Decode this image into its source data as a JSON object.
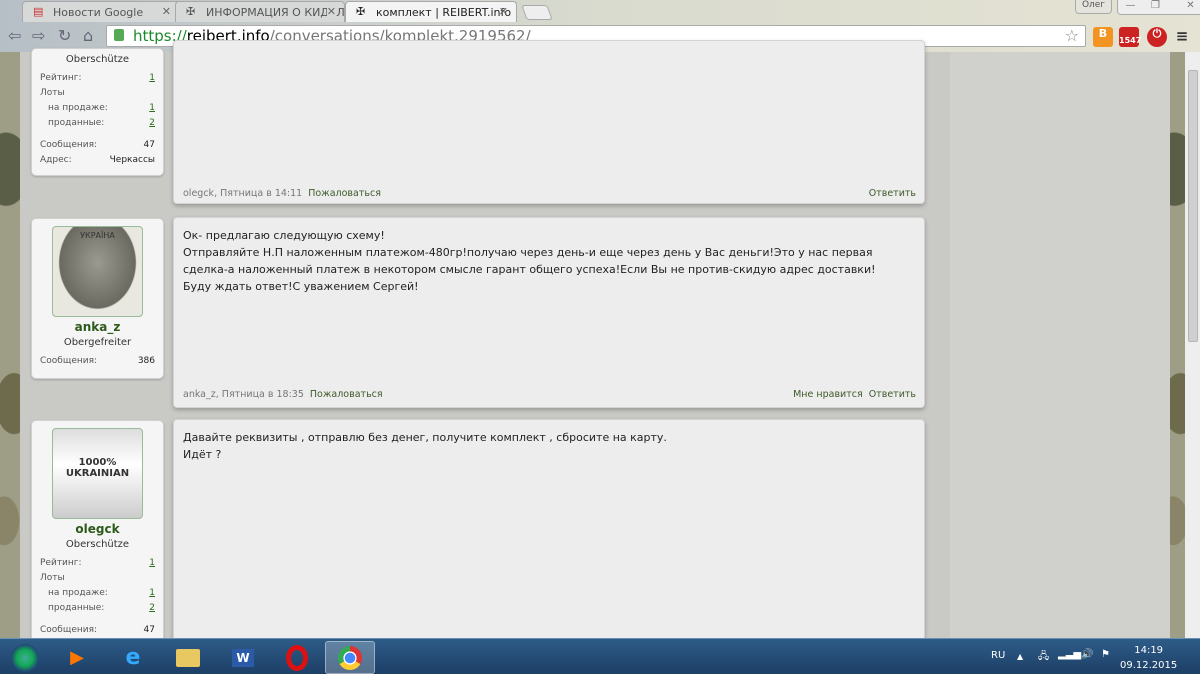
{
  "browser": {
    "tabs": [
      {
        "label": "Новости Google"
      },
      {
        "label": "ИНФОРМАЦИЯ О КИДАЛАХ"
      },
      {
        "label": "комплект | REIBERT.info",
        "active": true
      }
    ],
    "user_badge": "Олег",
    "url": {
      "scheme": "https://",
      "domain": "reibert.info",
      "path": "/conversations/komplekt.2919562/"
    },
    "mail_count": "1547"
  },
  "posts": [
    {
      "user": {
        "title": "Oberschütze",
        "rating_label": "Рейтинг:",
        "rating": "1",
        "lots_label": "Лоты",
        "on_sale_label": "на продаже:",
        "on_sale": "1",
        "sold_label": "проданные:",
        "sold": "2",
        "messages_label": "Сообщения:",
        "messages": "47",
        "address_label": "Адрес:",
        "address": "Черкассы"
      },
      "author": "olegck",
      "date": "Пятница в 14:11",
      "report": "Пожаловаться",
      "reply": "Ответить"
    },
    {
      "user": {
        "name": "anka_z",
        "title": "Obergefreiter",
        "messages_label": "Сообщения:",
        "messages": "386",
        "avatar_caption": "УКРАЇНА"
      },
      "lines": [
        "Ок- предлагаю следующую схему!",
        "Отправляйте Н.П наложенным платежом-480гр!получаю через день-и еще через день у Вас деньги!Это у нас первая сделка-а наложенный платеж в некотором смысле гарант общего успеха!Если Вы не против-скидую адрес доставки!",
        "Буду ждать ответ!С уважением Сергей!"
      ],
      "author": "anka_z",
      "date": "Пятница в 18:35",
      "report": "Пожаловаться",
      "like": "Мне нравится",
      "reply": "Ответить"
    },
    {
      "user": {
        "name": "olegck",
        "title": "Oberschütze",
        "rating_label": "Рейтинг:",
        "rating": "1",
        "lots_label": "Лоты",
        "on_sale_label": "на продаже:",
        "on_sale": "1",
        "sold_label": "проданные:",
        "sold": "2",
        "messages_label": "Сообщения:",
        "messages": "47",
        "avatar_caption": "1000% UKRAINIAN"
      },
      "lines": [
        "Давайте реквизиты , отправлю без денег, получите комплект , сбросите на карту.",
        "Идёт ?"
      ]
    }
  ],
  "taskbar": {
    "lang": "RU",
    "time": "14:19",
    "date": "09.12.2015"
  }
}
